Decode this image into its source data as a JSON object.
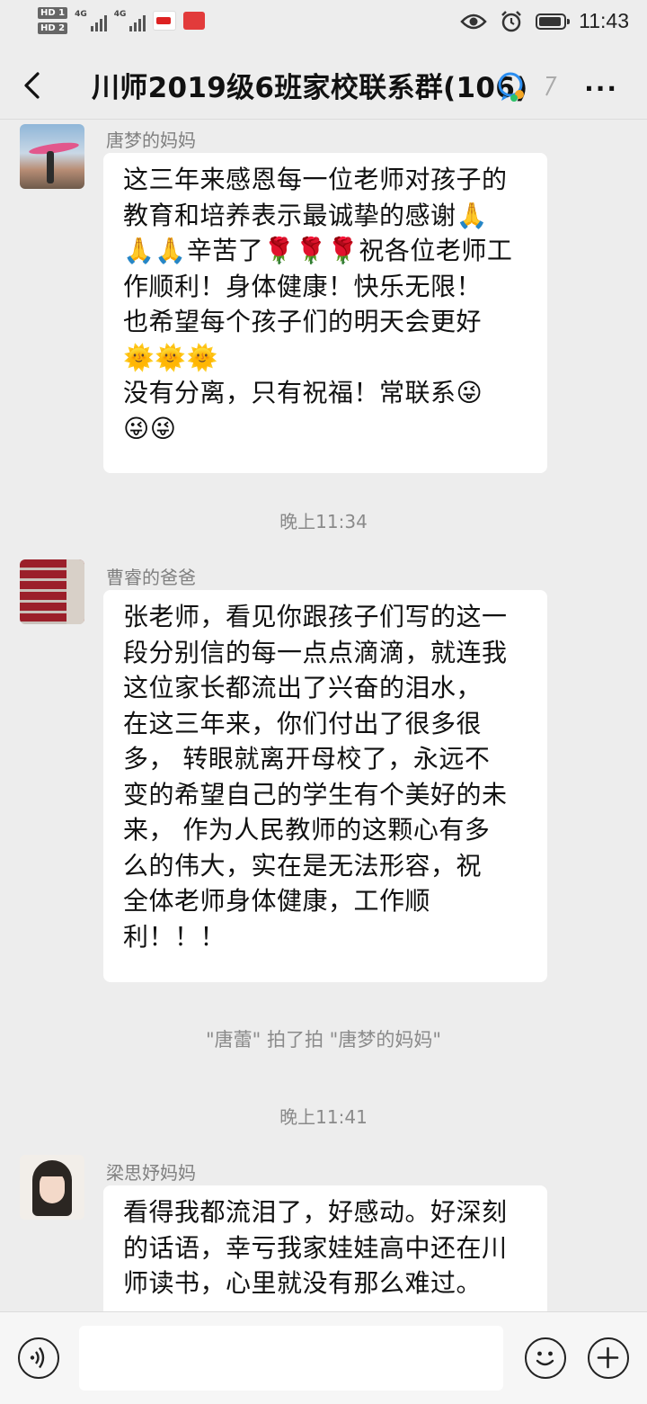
{
  "status": {
    "hd1": "HD 1",
    "hd2": "HD 2",
    "net1": "4G",
    "net2": "4G",
    "time": "11:43"
  },
  "header": {
    "title": "川师2019级6班家校联系群(106)"
  },
  "timeline": {
    "time1": "晚上11:34",
    "pat": "\"唐蕾\" 拍了拍 \"唐梦的妈妈\"",
    "time2": "晚上11:41"
  },
  "messages": [
    {
      "sender": "唐梦的妈妈",
      "lines": [
        "这三年来感恩每一位老师对孩子的",
        "教育和培养表示最诚挚的感谢🙏",
        "🙏🙏辛苦了🌹🌹🌹祝各位老师工",
        "作顺利！身体健康！快乐无限！",
        "也希望每个孩子们的明天会更好",
        "🌞🌞🌞",
        "没有分离，只有祝福！常联系😜",
        "😜😜"
      ]
    },
    {
      "sender": "曹睿的爸爸",
      "lines": [
        "张老师，看见你跟孩子们写的这一",
        "段分别信的每一点点滴滴，就连我",
        "这位家长都流出了兴奋的泪水，",
        "在这三年来，你们付出了很多很",
        "多， 转眼就离开母校了，永远不",
        "变的希望自己的学生有个美好的未",
        "来， 作为人民教师的这颗心有多",
        "么的伟大，实在是无法形容，祝",
        "全体老师身体健康，工作顺",
        "利！！！"
      ]
    },
    {
      "sender": "梁思妤妈妈",
      "lines": [
        "看得我都流泪了，好感动。好深刻",
        "的话语，幸亏我家娃娃高中还在川",
        "师读书，心里就没有那么难过。"
      ]
    }
  ],
  "icons": {
    "back": "chevron-left-icon",
    "more": "more-dots-icon",
    "voice": "voice-icon",
    "emoji": "emoji-icon",
    "plus": "plus-icon"
  },
  "colors": {
    "background": "#ededed",
    "bubble": "#ffffff",
    "meta_text": "#8a8a8a"
  }
}
